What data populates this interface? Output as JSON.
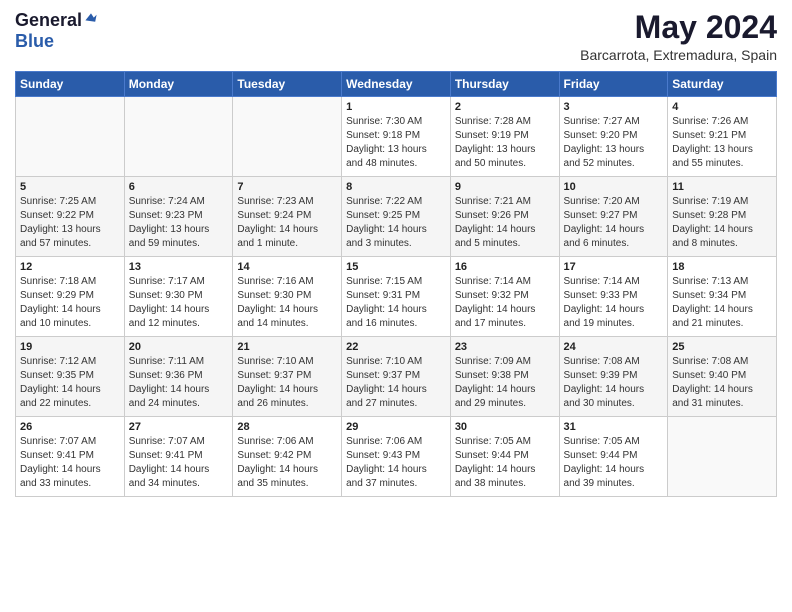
{
  "header": {
    "logo_general": "General",
    "logo_blue": "Blue",
    "month_title": "May 2024",
    "location": "Barcarrota, Extremadura, Spain"
  },
  "days_header": [
    "Sunday",
    "Monday",
    "Tuesday",
    "Wednesday",
    "Thursday",
    "Friday",
    "Saturday"
  ],
  "weeks": [
    [
      {
        "day": "",
        "content": ""
      },
      {
        "day": "",
        "content": ""
      },
      {
        "day": "",
        "content": ""
      },
      {
        "day": "1",
        "content": "Sunrise: 7:30 AM\nSunset: 9:18 PM\nDaylight: 13 hours\nand 48 minutes."
      },
      {
        "day": "2",
        "content": "Sunrise: 7:28 AM\nSunset: 9:19 PM\nDaylight: 13 hours\nand 50 minutes."
      },
      {
        "day": "3",
        "content": "Sunrise: 7:27 AM\nSunset: 9:20 PM\nDaylight: 13 hours\nand 52 minutes."
      },
      {
        "day": "4",
        "content": "Sunrise: 7:26 AM\nSunset: 9:21 PM\nDaylight: 13 hours\nand 55 minutes."
      }
    ],
    [
      {
        "day": "5",
        "content": "Sunrise: 7:25 AM\nSunset: 9:22 PM\nDaylight: 13 hours\nand 57 minutes."
      },
      {
        "day": "6",
        "content": "Sunrise: 7:24 AM\nSunset: 9:23 PM\nDaylight: 13 hours\nand 59 minutes."
      },
      {
        "day": "7",
        "content": "Sunrise: 7:23 AM\nSunset: 9:24 PM\nDaylight: 14 hours\nand 1 minute."
      },
      {
        "day": "8",
        "content": "Sunrise: 7:22 AM\nSunset: 9:25 PM\nDaylight: 14 hours\nand 3 minutes."
      },
      {
        "day": "9",
        "content": "Sunrise: 7:21 AM\nSunset: 9:26 PM\nDaylight: 14 hours\nand 5 minutes."
      },
      {
        "day": "10",
        "content": "Sunrise: 7:20 AM\nSunset: 9:27 PM\nDaylight: 14 hours\nand 6 minutes."
      },
      {
        "day": "11",
        "content": "Sunrise: 7:19 AM\nSunset: 9:28 PM\nDaylight: 14 hours\nand 8 minutes."
      }
    ],
    [
      {
        "day": "12",
        "content": "Sunrise: 7:18 AM\nSunset: 9:29 PM\nDaylight: 14 hours\nand 10 minutes."
      },
      {
        "day": "13",
        "content": "Sunrise: 7:17 AM\nSunset: 9:30 PM\nDaylight: 14 hours\nand 12 minutes."
      },
      {
        "day": "14",
        "content": "Sunrise: 7:16 AM\nSunset: 9:30 PM\nDaylight: 14 hours\nand 14 minutes."
      },
      {
        "day": "15",
        "content": "Sunrise: 7:15 AM\nSunset: 9:31 PM\nDaylight: 14 hours\nand 16 minutes."
      },
      {
        "day": "16",
        "content": "Sunrise: 7:14 AM\nSunset: 9:32 PM\nDaylight: 14 hours\nand 17 minutes."
      },
      {
        "day": "17",
        "content": "Sunrise: 7:14 AM\nSunset: 9:33 PM\nDaylight: 14 hours\nand 19 minutes."
      },
      {
        "day": "18",
        "content": "Sunrise: 7:13 AM\nSunset: 9:34 PM\nDaylight: 14 hours\nand 21 minutes."
      }
    ],
    [
      {
        "day": "19",
        "content": "Sunrise: 7:12 AM\nSunset: 9:35 PM\nDaylight: 14 hours\nand 22 minutes."
      },
      {
        "day": "20",
        "content": "Sunrise: 7:11 AM\nSunset: 9:36 PM\nDaylight: 14 hours\nand 24 minutes."
      },
      {
        "day": "21",
        "content": "Sunrise: 7:10 AM\nSunset: 9:37 PM\nDaylight: 14 hours\nand 26 minutes."
      },
      {
        "day": "22",
        "content": "Sunrise: 7:10 AM\nSunset: 9:37 PM\nDaylight: 14 hours\nand 27 minutes."
      },
      {
        "day": "23",
        "content": "Sunrise: 7:09 AM\nSunset: 9:38 PM\nDaylight: 14 hours\nand 29 minutes."
      },
      {
        "day": "24",
        "content": "Sunrise: 7:08 AM\nSunset: 9:39 PM\nDaylight: 14 hours\nand 30 minutes."
      },
      {
        "day": "25",
        "content": "Sunrise: 7:08 AM\nSunset: 9:40 PM\nDaylight: 14 hours\nand 31 minutes."
      }
    ],
    [
      {
        "day": "26",
        "content": "Sunrise: 7:07 AM\nSunset: 9:41 PM\nDaylight: 14 hours\nand 33 minutes."
      },
      {
        "day": "27",
        "content": "Sunrise: 7:07 AM\nSunset: 9:41 PM\nDaylight: 14 hours\nand 34 minutes."
      },
      {
        "day": "28",
        "content": "Sunrise: 7:06 AM\nSunset: 9:42 PM\nDaylight: 14 hours\nand 35 minutes."
      },
      {
        "day": "29",
        "content": "Sunrise: 7:06 AM\nSunset: 9:43 PM\nDaylight: 14 hours\nand 37 minutes."
      },
      {
        "day": "30",
        "content": "Sunrise: 7:05 AM\nSunset: 9:44 PM\nDaylight: 14 hours\nand 38 minutes."
      },
      {
        "day": "31",
        "content": "Sunrise: 7:05 AM\nSunset: 9:44 PM\nDaylight: 14 hours\nand 39 minutes."
      },
      {
        "day": "",
        "content": ""
      }
    ]
  ]
}
